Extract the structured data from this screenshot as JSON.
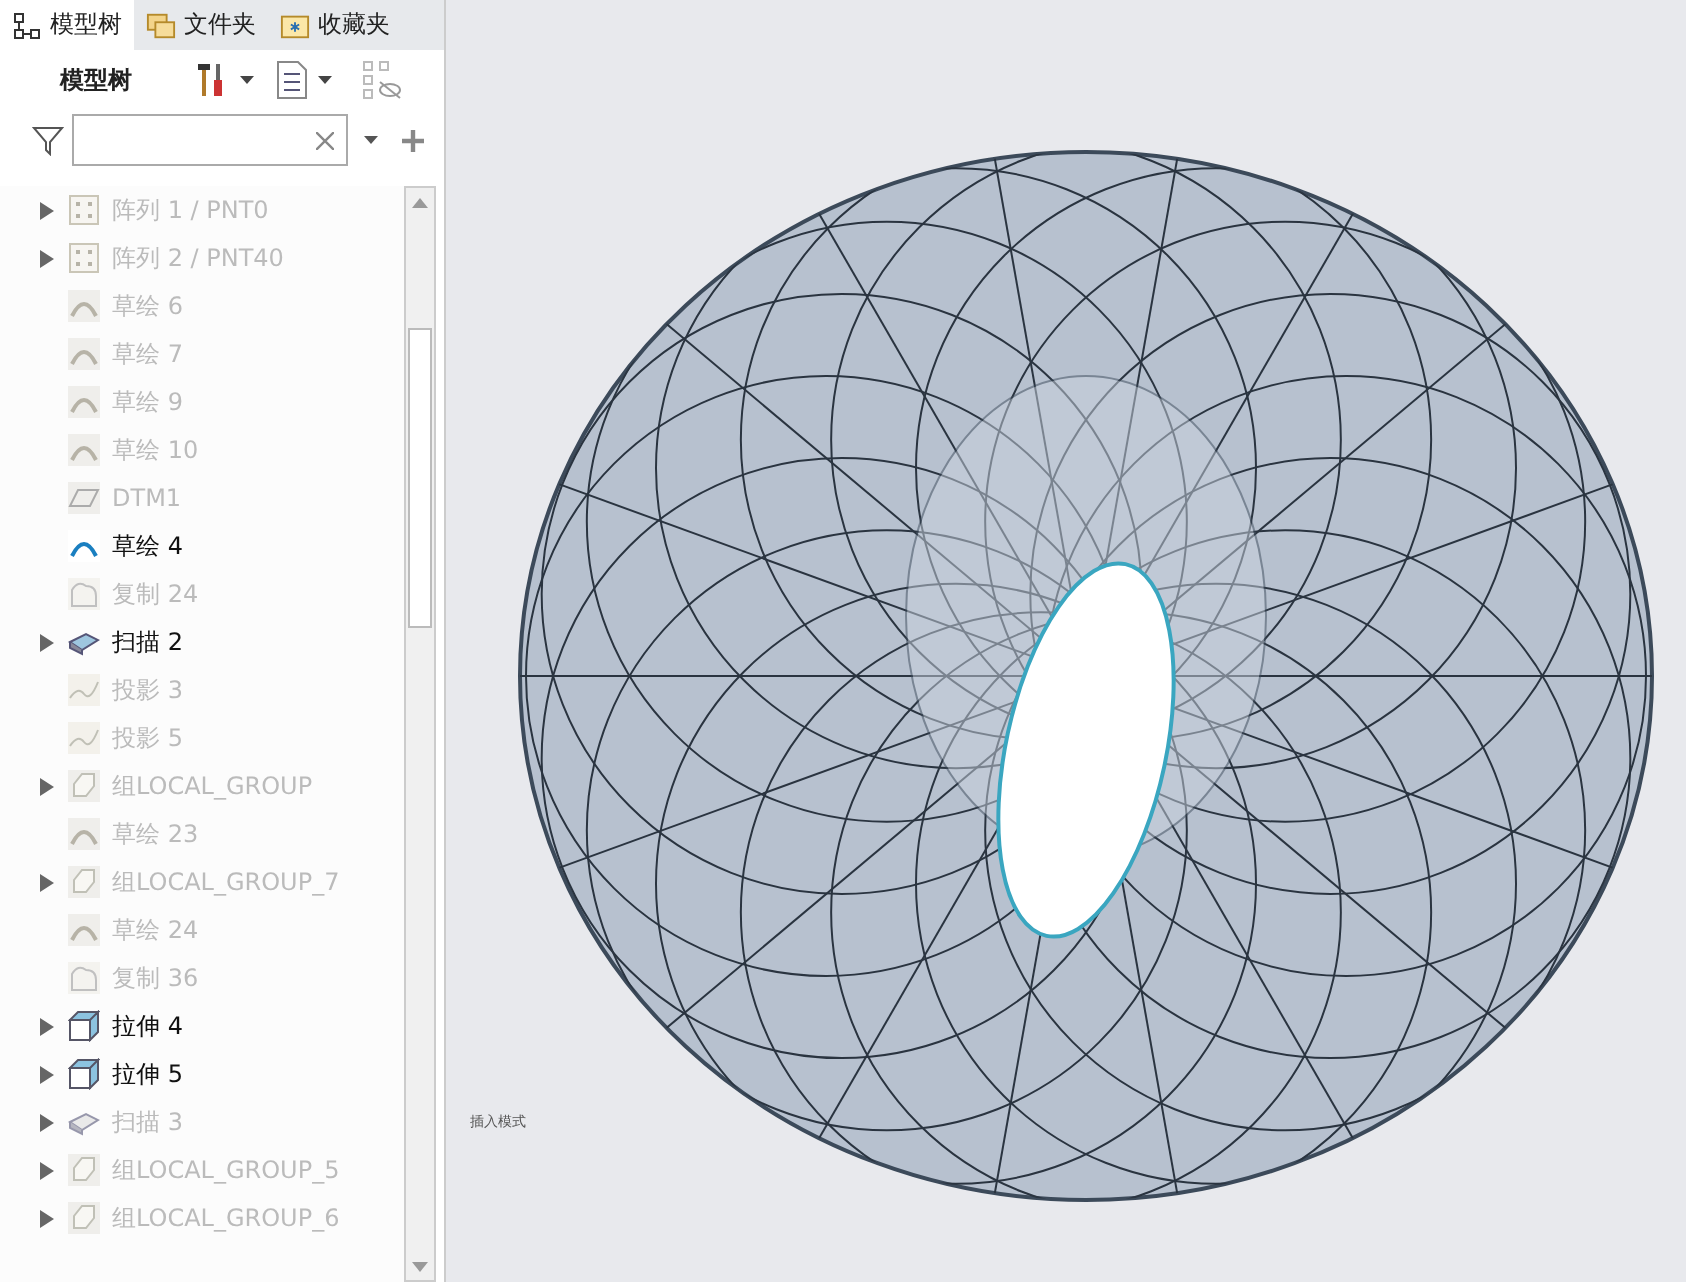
{
  "tabs": [
    {
      "label": "模型树",
      "selected": true
    },
    {
      "label": "文件夹",
      "selected": false
    },
    {
      "label": "收藏夹",
      "selected": false
    }
  ],
  "toolbar": {
    "title": "模型树"
  },
  "tree": [
    {
      "label": "阵列 1 / PNT0",
      "kind": "pattern",
      "expandable": true,
      "disabled": true
    },
    {
      "label": "阵列 2 / PNT40",
      "kind": "pattern",
      "expandable": true,
      "disabled": true
    },
    {
      "label": "草绘 6",
      "kind": "sketch",
      "expandable": false,
      "disabled": true
    },
    {
      "label": "草绘 7",
      "kind": "sketch",
      "expandable": false,
      "disabled": true
    },
    {
      "label": "草绘 9",
      "kind": "sketch",
      "expandable": false,
      "disabled": true
    },
    {
      "label": "草绘 10",
      "kind": "sketch",
      "expandable": false,
      "disabled": true
    },
    {
      "label": "DTM1",
      "kind": "datum",
      "expandable": false,
      "disabled": true
    },
    {
      "label": "草绘 4",
      "kind": "sketch",
      "expandable": false,
      "disabled": false
    },
    {
      "label": "复制 24",
      "kind": "copy",
      "expandable": false,
      "disabled": true
    },
    {
      "label": "扫描 2",
      "kind": "sweep",
      "expandable": true,
      "disabled": false
    },
    {
      "label": "投影 3",
      "kind": "projection",
      "expandable": false,
      "disabled": true
    },
    {
      "label": "投影 5",
      "kind": "projection",
      "expandable": false,
      "disabled": true
    },
    {
      "label": "组LOCAL_GROUP",
      "kind": "group",
      "expandable": true,
      "disabled": true
    },
    {
      "label": "草绘 23",
      "kind": "sketch",
      "expandable": false,
      "disabled": true
    },
    {
      "label": "组LOCAL_GROUP_7",
      "kind": "group",
      "expandable": true,
      "disabled": true
    },
    {
      "label": "草绘 24",
      "kind": "sketch",
      "expandable": false,
      "disabled": true
    },
    {
      "label": "复制 36",
      "kind": "copy",
      "expandable": false,
      "disabled": true
    },
    {
      "label": "拉伸 4",
      "kind": "extrude",
      "expandable": true,
      "disabled": false
    },
    {
      "label": "拉伸 5",
      "kind": "extrude",
      "expandable": true,
      "disabled": false
    },
    {
      "label": "扫描 3",
      "kind": "sweep",
      "expandable": true,
      "disabled": true
    },
    {
      "label": "组LOCAL_GROUP_5",
      "kind": "group",
      "expandable": true,
      "disabled": true
    },
    {
      "label": "组LOCAL_GROUP_6",
      "kind": "group",
      "expandable": true,
      "disabled": true
    }
  ],
  "viewport": {
    "mode_label": "插入模式"
  }
}
